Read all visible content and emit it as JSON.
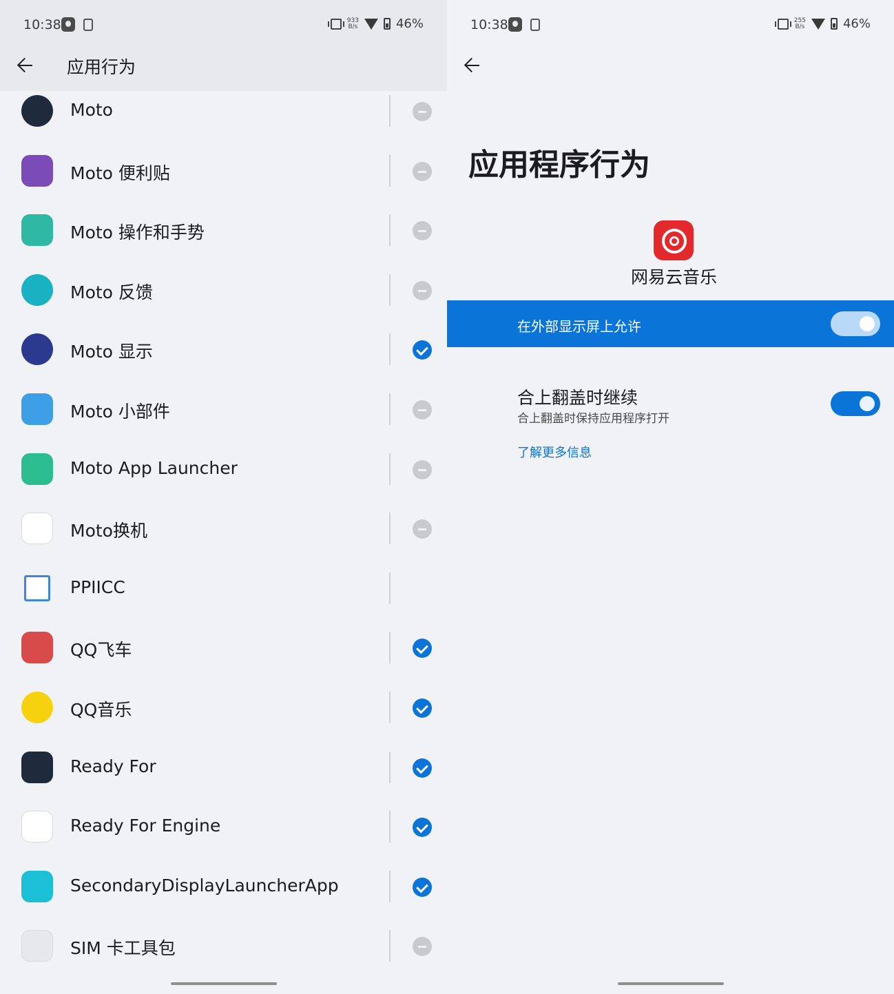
{
  "status_left": {
    "time": "10:38",
    "net_speed_top": "933",
    "net_speed_bottom": "B/s",
    "battery": "46%"
  },
  "status_right": {
    "time": "10:38",
    "net_speed_top": "255",
    "net_speed_bottom": "B/s",
    "battery": "46%"
  },
  "left_header": {
    "title": "应用行为"
  },
  "apps": [
    {
      "label": "Moto",
      "state": "minus",
      "icon": "moto-logo-icon",
      "color": "#1f2a3d"
    },
    {
      "label": "Moto 便利贴",
      "state": "minus",
      "icon": "sticky-note-icon",
      "color": "#7b4bb8"
    },
    {
      "label": "Moto 操作和手势",
      "state": "minus",
      "icon": "gesture-hand-icon",
      "color": "#2fb9a4"
    },
    {
      "label": "Moto 反馈",
      "state": "minus",
      "icon": "feedback-icon",
      "color": "#19b2c2"
    },
    {
      "label": "Moto 显示",
      "state": "check",
      "icon": "moto-display-icon",
      "color": "#2b3a8f"
    },
    {
      "label": "Moto 小部件",
      "state": "minus",
      "icon": "weather-widget-icon",
      "color": "#3da0e6"
    },
    {
      "label": "Moto App Launcher",
      "state": "minus",
      "icon": "home-launcher-icon",
      "color": "#2cbd8e"
    },
    {
      "label": "Moto换机",
      "state": "minus",
      "icon": "phone-migrate-icon",
      "color": "#ffffff"
    },
    {
      "label": "PPIICC",
      "state": "none",
      "icon": "ppiicc-icon",
      "color": "#3f86d8"
    },
    {
      "label": "QQ飞车",
      "state": "check",
      "icon": "qq-speed-icon",
      "color": "#d94b4b"
    },
    {
      "label": "QQ音乐",
      "state": "check",
      "icon": "qq-music-icon",
      "color": "#f6d20e"
    },
    {
      "label": "Ready For",
      "state": "check",
      "icon": "ready-for-icon",
      "color": "#1f2a3d"
    },
    {
      "label": "Ready For Engine",
      "state": "check",
      "icon": "ready-for-engine-icon",
      "color": "#ffffff"
    },
    {
      "label": "SecondaryDisplayLauncherApp",
      "state": "check",
      "icon": "secondary-display-icon",
      "color": "#1bc0d6"
    },
    {
      "label": "SIM 卡工具包",
      "state": "minus",
      "icon": "sim-card-icon",
      "color": "#e6e8ec"
    }
  ],
  "right": {
    "title": "应用程序行为",
    "app_name": "网易云音乐",
    "allow_label": "在外部显示屏上允许",
    "allow_on": true,
    "continue_title": "合上翻盖时继续",
    "continue_sub": "合上翻盖时保持应用程序打开",
    "continue_on": true,
    "learn_more": "了解更多信息"
  },
  "colors": {
    "accent": "#0b74d8",
    "background": "#f1f2f6",
    "header": "#e8e9ed"
  }
}
